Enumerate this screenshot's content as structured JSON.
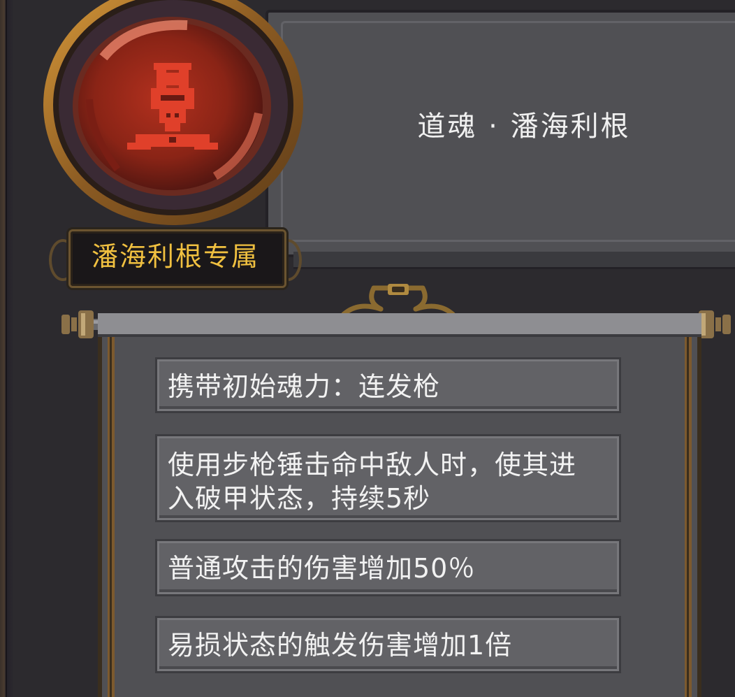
{
  "skill": {
    "title": "道魂 · 潘海利根",
    "exclusive_tag": "潘海利根专属"
  },
  "effects": [
    "携带初始魂力：连发枪",
    "使用步枪锤击命中敌人时，使其进入破甲状态，持续5秒",
    "普通攻击的伤害增加50％",
    "易损状态的触发伤害增加1倍"
  ],
  "colors": {
    "panel": "#505054",
    "title_text": "#f0f0f0",
    "tag_text": "#f0c040",
    "emblem_red": "#c23a22",
    "ring_gold": "#b07a2a"
  },
  "icons": {
    "emblem": "red-helmet-soul-emblem",
    "ornament": "bronze-scroll-ornament"
  }
}
